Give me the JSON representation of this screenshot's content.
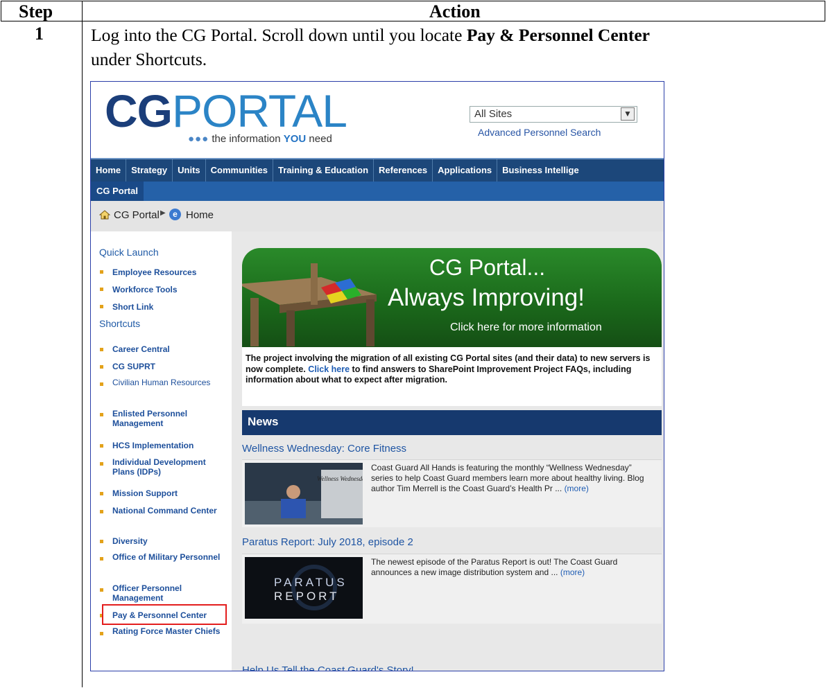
{
  "table": {
    "header_step": "Step",
    "header_action": "Action",
    "step_number": "1",
    "instruction_part1": "Log into the CG Portal.  Scroll down until you locate ",
    "instruction_bold": "Pay & Personnel Center",
    "instruction_part2": "under Shortcuts."
  },
  "portal": {
    "logo_cg": "CG",
    "logo_portal": "PORTAL",
    "tagline_pre": "the information ",
    "tagline_you": "YOU",
    "tagline_post": " need",
    "site_select": "All Sites",
    "advanced_search": "Advanced Personnel Search",
    "topnav": [
      "Home",
      "Strategy",
      "Units",
      "Communities",
      "Training & Education",
      "References",
      "Applications",
      "Business Intellige"
    ],
    "subnav": "CG Portal",
    "breadcrumb": [
      "CG Portal",
      "Home"
    ],
    "quick_launch_head": "Quick Launch",
    "quick_launch": [
      "Employee Resources",
      "Workforce Tools",
      "Short Link"
    ],
    "shortcuts_head": "Shortcuts",
    "shortcuts": [
      "Career Central",
      "CG SUPRT",
      "Civilian Human Resources",
      "Enlisted Personnel Management",
      "HCS Implementation",
      "Individual Development Plans (IDPs)",
      "Mission Support",
      "National Command Center",
      "Diversity",
      "Office of Military Personnel",
      "Officer Personnel Management",
      "Pay & Personnel Center",
      "Rating Force Master Chiefs"
    ],
    "banner_line1": "CG Portal...",
    "banner_line2": "Always Improving!",
    "banner_line3": "Click here for more information",
    "announce_pre": "The project involving the migration of all existing CG Portal sites (and their data) to new servers is now complete. ",
    "announce_link": "Click here",
    "announce_post": " to find answers to SharePoint Improvement Project FAQs, including information about what to expect after migration.",
    "news_head": "News",
    "news": [
      {
        "title": "Wellness Wednesday: Core Fitness",
        "body": "Coast Guard All Hands is featuring the monthly “Wellness Wednesday” series to help Coast Guard members learn more about healthy living. Blog author Tim Merrell is the Coast Guard’s Health Pr ... ",
        "more": "(more)",
        "thumb_text": "Wellness Wednesday"
      },
      {
        "title": "Paratus Report: July 2018, episode 2",
        "body": "The newest episode of the Paratus Report is out! The Coast Guard announces a new image distribution system and ... ",
        "more": "(more)",
        "thumb_line1": "PARATUS",
        "thumb_line2": "REPORT"
      },
      {
        "title": "Help Us Tell the Coast Guard's Story!"
      }
    ]
  }
}
